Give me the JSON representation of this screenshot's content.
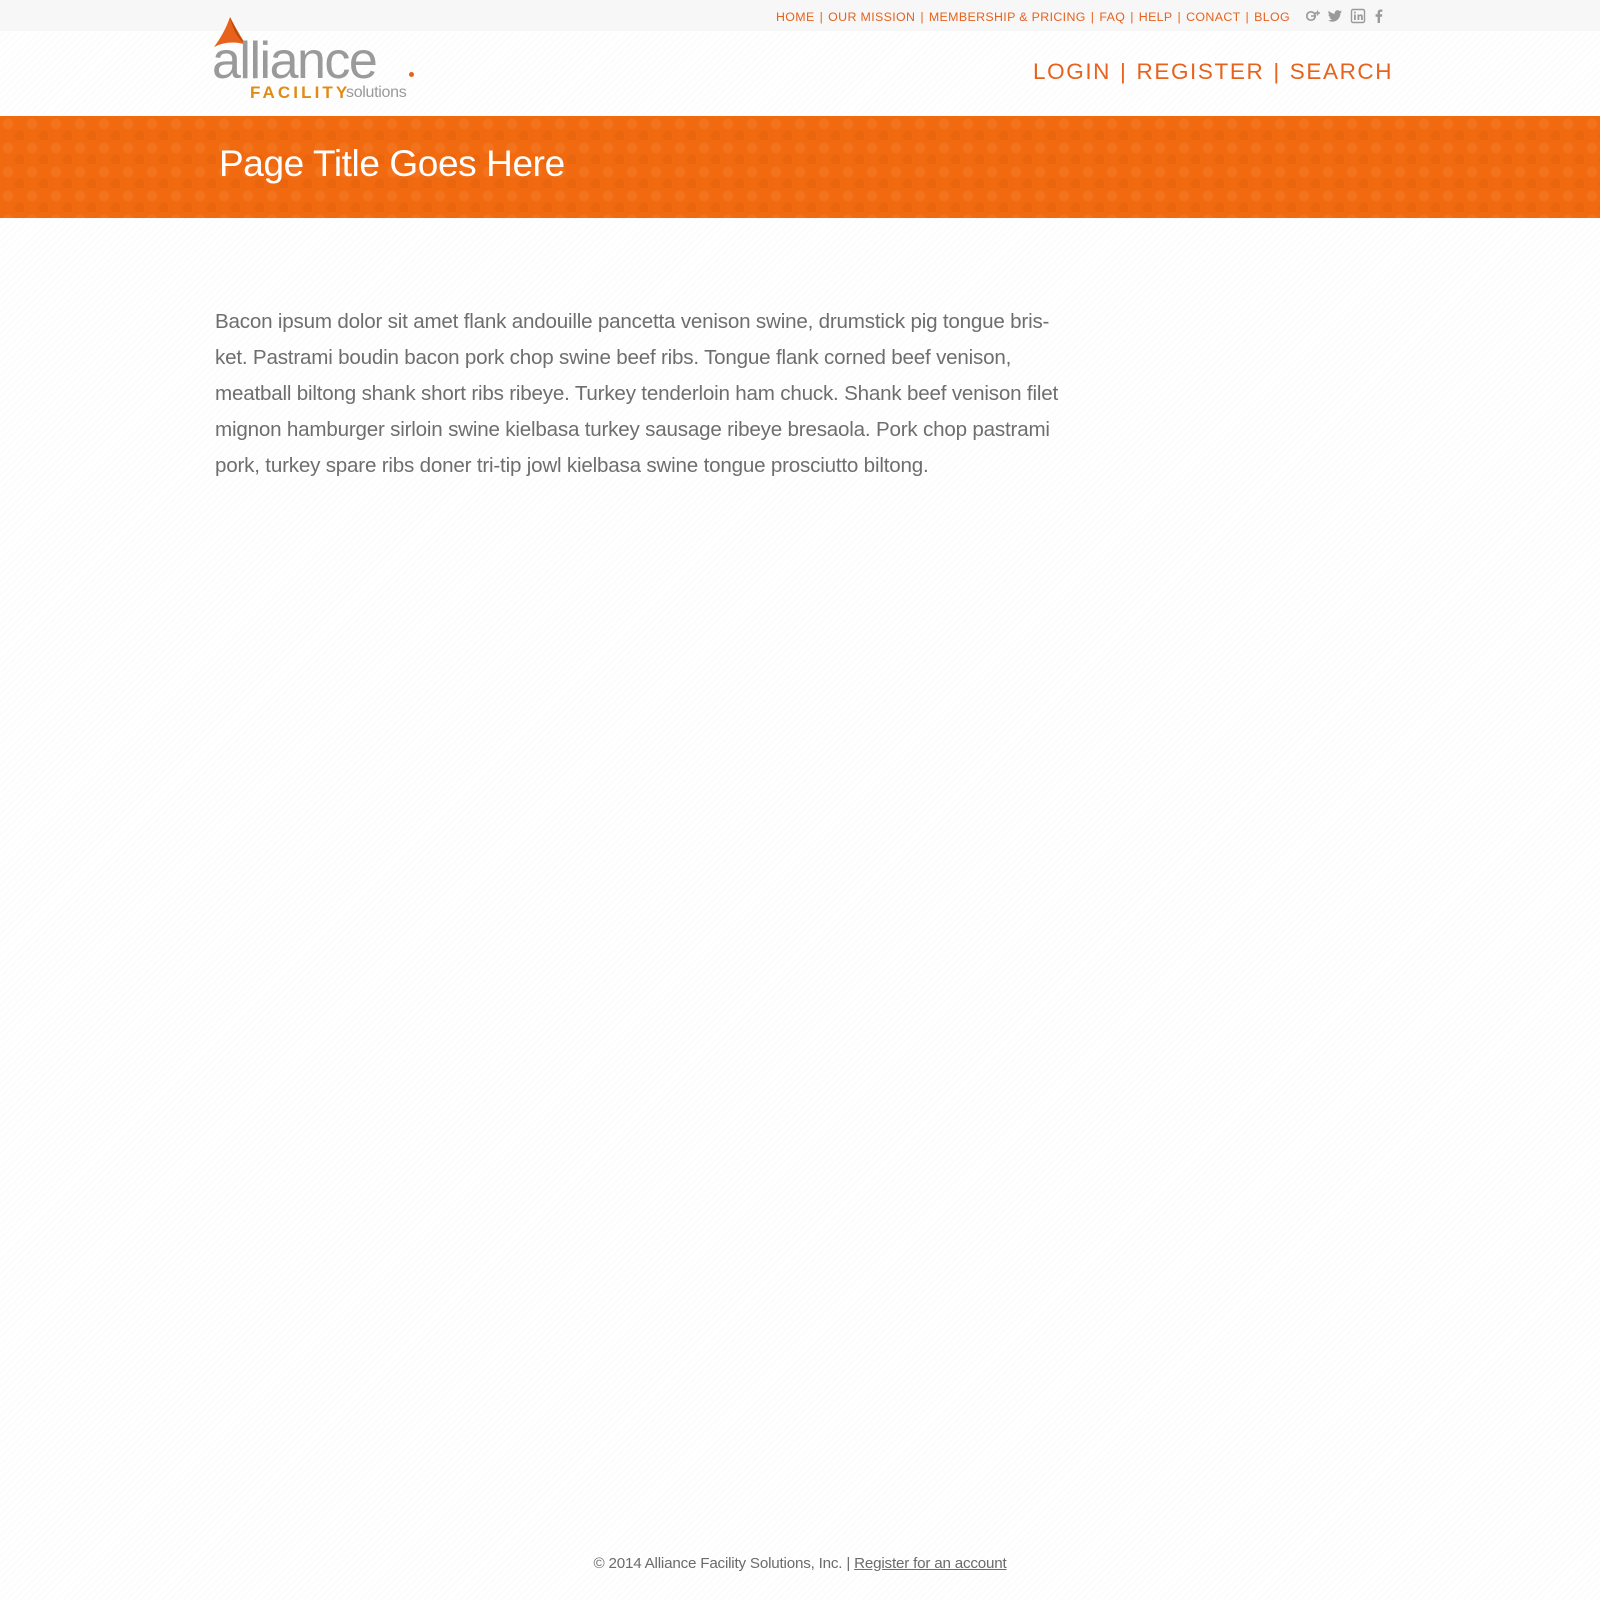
{
  "top_nav": {
    "items": [
      "HOME",
      "OUR MISSION",
      "MEMBERSHIP & PRICING",
      "FAQ",
      "HELP",
      "CONACT",
      "BLOG"
    ],
    "separator": "|"
  },
  "social_icons": [
    "google-plus-icon",
    "twitter-icon",
    "linkedin-icon",
    "facebook-icon"
  ],
  "logo": {
    "word": "alliance",
    "facility": "FACILITY",
    "solutions": "solutions"
  },
  "auth_nav": {
    "login": "LOGIN",
    "register": "REGISTER",
    "search": "SEARCH",
    "separator": "|"
  },
  "banner": {
    "title": "Page Title Goes Here"
  },
  "content": {
    "lines": [
      "Bacon ipsum dolor sit amet flank andouille pancetta venison swine, drumstick pig tongue bris-",
      "ket. Pastrami boudin bacon pork chop swine beef ribs. Tongue flank corned beef venison,",
      "meatball biltong shank short ribs ribeye. Turkey tenderloin ham chuck. Shank beef venison filet",
      "mignon hamburger sirloin swine kielbasa turkey sausage ribeye bresaola. Pork chop pastrami",
      "pork, turkey spare ribs doner tri-tip jowl kielbasa swine tongue prosciutto biltong."
    ]
  },
  "footer": {
    "copyright": "© 2014 Alliance Facility Solutions, Inc. |",
    "register_link": "Register for an account"
  },
  "colors": {
    "brand_orange": "#f26a10",
    "nav_orange": "#e8621c",
    "logo_gold": "#e08b14",
    "text_gray": "#6e6e6e",
    "logo_gray": "#9a9a9a"
  }
}
